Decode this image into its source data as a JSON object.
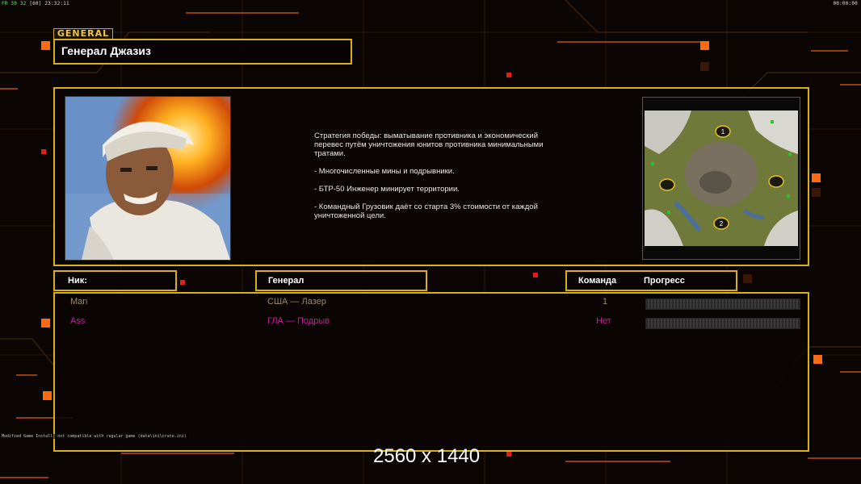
{
  "topbar": {
    "fps": "FR 30 32",
    "sep": "[60]",
    "clock": "23:32:11",
    "timer": "00:00:00"
  },
  "general_tag": "GENERAL",
  "title": "Генерал Джазиз",
  "description": [
    "Стратегия победы: выматывание противника и экономический перевес путём уничтожения юнитов противника минимальными тратами.",
    "- Многочисленные мины и подрывники.",
    "- БТР-50 Инженер минирует территории.",
    "- Командный Грузовик даёт со старта 3% стоимости от каждой уничтоженной цели."
  ],
  "minimap": {
    "markers": [
      "1",
      "2"
    ]
  },
  "columns": {
    "nick": "Ник:",
    "general": "Генерал",
    "team": "Команда",
    "progress": "Прогресс"
  },
  "players": [
    {
      "nick": "Man",
      "general": "США — Лазер",
      "team": "1",
      "color": "#9a8a6a",
      "progress": 0
    },
    {
      "nick": "Ass",
      "general": "ГЛА — Подрыв",
      "team": "Нет",
      "color": "#c0209a",
      "progress": 0
    }
  ],
  "console_text": "Modified Game Install: not compatible with regular game (data\\ini\\crate.ini)",
  "watermark": "2560 x 1440",
  "colors": {
    "accent": "#d8b214",
    "orange": "#ff6a10"
  }
}
